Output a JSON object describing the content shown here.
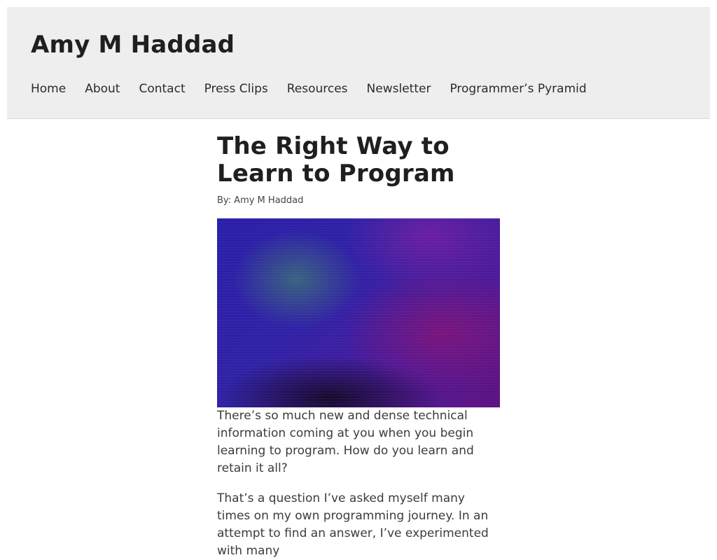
{
  "site": {
    "title": "Amy M Haddad"
  },
  "nav": {
    "items": [
      {
        "label": "Home"
      },
      {
        "label": "About"
      },
      {
        "label": "Contact"
      },
      {
        "label": "Press Clips"
      },
      {
        "label": "Resources"
      },
      {
        "label": "Newsletter"
      },
      {
        "label": "Programmer’s Pyramid"
      }
    ]
  },
  "article": {
    "title": "The Right Way to Learn to Program",
    "byline": "By: Amy M Haddad",
    "paragraphs": [
      "There’s so much new and dense technical information coming at you when you begin learning to program. How do you learn and retain it all?",
      "That’s a question I’ve asked myself many times on my own programming journey. In an attempt to find an answer, I’ve experimented with many"
    ]
  },
  "colors": {
    "header_bg": "#eeeeee",
    "text": "#222222"
  }
}
